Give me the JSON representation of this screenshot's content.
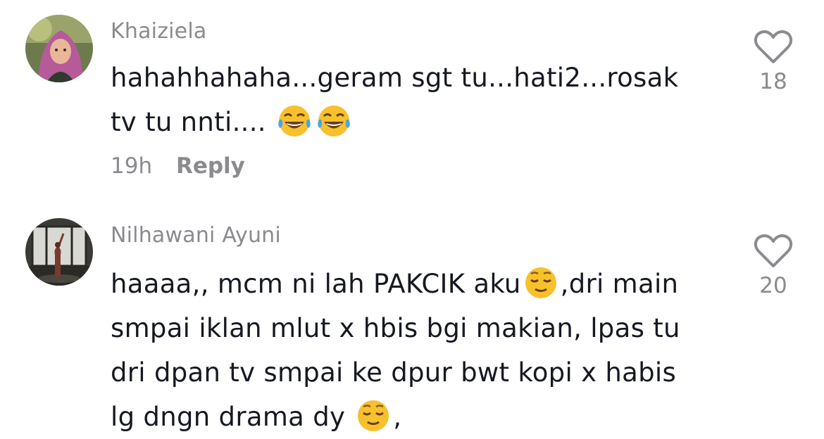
{
  "comments": [
    {
      "username": "Khaiziela",
      "text_line1": "hahahhahaha...geram sgt tu...hati2...rosak",
      "text_line2": "tv tu nnti....",
      "emoji": "laughing-with-tears-emoji",
      "time": "19h",
      "reply_label": "Reply",
      "likes": "18"
    },
    {
      "username": "Nilhawani Ayuni",
      "text_part1": "haaaa,, mcm ni lah PAKCIK aku",
      "text_part2": ",dri main",
      "text_line2": "smpai iklan mlut x hbis bgi makian, lpas tu",
      "text_line3": "dri dpan tv smpai ke dpur bwt kopi x habis",
      "text_line4": "lg dngn drama dy ",
      "text_end": ",",
      "emoji": "relieved-face-emoji",
      "likes": "20"
    }
  ],
  "colors": {
    "text": "#161823",
    "secondary": "#8a8a8f",
    "background": "#ffffff"
  }
}
